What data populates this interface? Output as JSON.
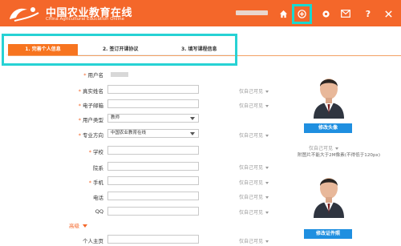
{
  "header": {
    "title": "中国农业教育在线",
    "subtitle": "China Agricultural Education Online",
    "icons": [
      "home-icon",
      "add-circle-icon",
      "user-settings-icon",
      "mail-icon",
      "help-icon",
      "close-icon"
    ]
  },
  "steps": [
    {
      "label": "1. 完善个人信息",
      "active": true
    },
    {
      "label": "2. 签订开课协议",
      "active": false
    },
    {
      "label": "3. 填写课程信息",
      "active": false
    }
  ],
  "form": {
    "username_label": "用户名",
    "realname_label": "真实姓名",
    "email_label": "电子邮箱",
    "usertype_label": "用户类型",
    "usertype_value": "教师",
    "major_label": "专业方向",
    "major_value": "中国农业教育在线",
    "school_label": "学校",
    "department_label": "院系",
    "mobile_label": "手机",
    "phone_label": "电话",
    "qq_label": "QQ",
    "advanced_label": "高级",
    "homepage_label": "个人主页",
    "privacy_label": "仅自己可见"
  },
  "sidebar": {
    "avatar_button": "修改头像",
    "avatar_privacy": "仅自己可见",
    "avatar_note": "附图片不能大于2M像素(不得低于120px)",
    "cert_button": "修改证件照"
  },
  "colors": {
    "brand": "#f4672a",
    "highlight": "#27d2d4",
    "button": "#1f8fe0"
  }
}
